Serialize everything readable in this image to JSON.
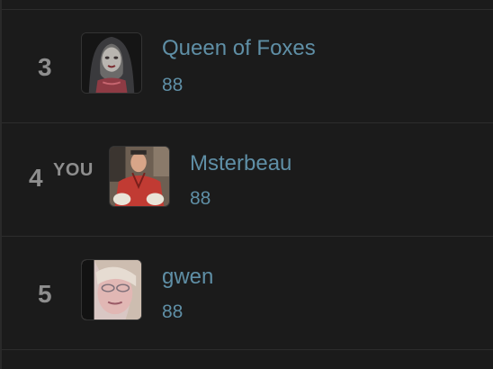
{
  "leaderboard": {
    "rows": [
      {
        "rank": "3",
        "name": "Queen of Foxes",
        "score": "88",
        "you_label": "",
        "avatar_icon": "hooded-woman-avatar"
      },
      {
        "rank": "4",
        "name": "Msterbeau",
        "score": "88",
        "you_label": "YOU",
        "avatar_icon": "man-red-shirt-avatar"
      },
      {
        "rank": "5",
        "name": "gwen",
        "score": "88",
        "you_label": "",
        "avatar_icon": "woman-glasses-avatar"
      }
    ]
  },
  "colors": {
    "background": "#1b1b1b",
    "rank_text": "#8e8e8e",
    "name_text": "#5f8fa6",
    "divider": "#2d2d2d"
  }
}
